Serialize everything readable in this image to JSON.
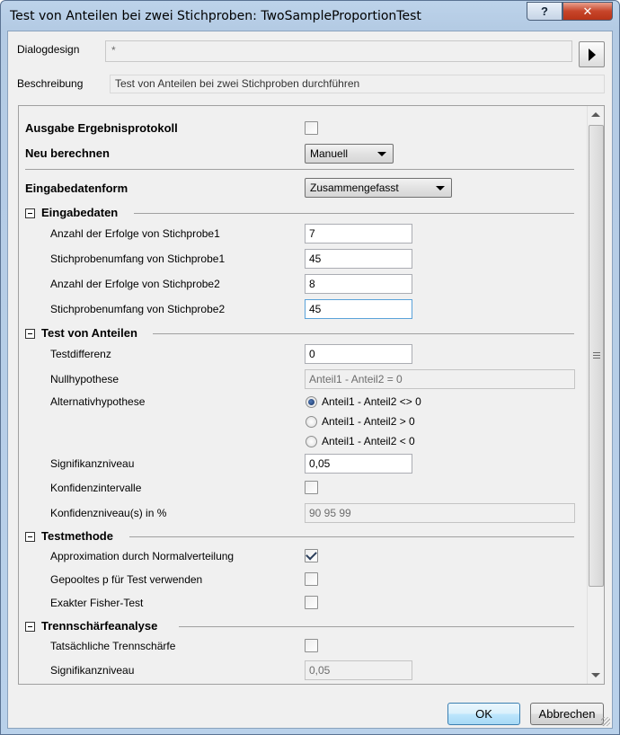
{
  "window": {
    "title": "Test von Anteilen bei zwei Stichproben: TwoSampleProportionTest",
    "help_label": "?",
    "close_label": "✕"
  },
  "header": {
    "design_label": "Dialogdesign",
    "design_value": "*",
    "description_label": "Beschreibung",
    "description_value": "Test von Anteilen bei zwei Stichproben durchführen"
  },
  "settings": {
    "output_log_label": "Ausgabe Ergebnisprotokoll",
    "output_log_checked": false,
    "recalc_label": "Neu berechnen",
    "recalc_value": "Manuell",
    "input_form_label": "Eingabedatenform",
    "input_form_value": "Zusammengefasst"
  },
  "input_data": {
    "title": "Eingabedaten",
    "success1_label": "Anzahl der Erfolge von Stichprobe1",
    "success1_value": "7",
    "size1_label": "Stichprobenumfang von Stichprobe1",
    "size1_value": "45",
    "success2_label": "Anzahl der Erfolge von Stichprobe2",
    "success2_value": "8",
    "size2_label": "Stichprobenumfang von Stichprobe2",
    "size2_value": "45"
  },
  "proportion_test": {
    "title": "Test von Anteilen",
    "diff_label": "Testdifferenz",
    "diff_value": "0",
    "null_label": "Nullhypothese",
    "null_value": "Anteil1 - Anteil2 = 0",
    "alt_label": "Alternativhypothese",
    "alt_options": [
      "Anteil1 - Anteil2 <> 0",
      "Anteil1 - Anteil2 > 0",
      "Anteil1 - Anteil2 < 0"
    ],
    "alt_selected": 0,
    "sig_label": "Signifikanzniveau",
    "sig_value": "0,05",
    "ci_label": "Konfidenzintervalle",
    "ci_checked": false,
    "ci_level_label": "Konfidenzniveau(s) in %",
    "ci_level_value": "90 95 99"
  },
  "test_method": {
    "title": "Testmethode",
    "normal_label": "Approximation durch Normalverteilung",
    "normal_checked": true,
    "pooled_label": "Gepooltes p für Test verwenden",
    "pooled_checked": false,
    "fisher_label": "Exakter Fisher-Test",
    "fisher_checked": false
  },
  "power": {
    "title": "Trennschärfeanalyse",
    "actual_label": "Tatsächliche Trennschärfe",
    "actual_checked": false,
    "sig_label": "Signifikanzniveau",
    "sig_value": "0,05"
  },
  "footer": {
    "ok_label": "OK",
    "cancel_label": "Abbrechen"
  }
}
